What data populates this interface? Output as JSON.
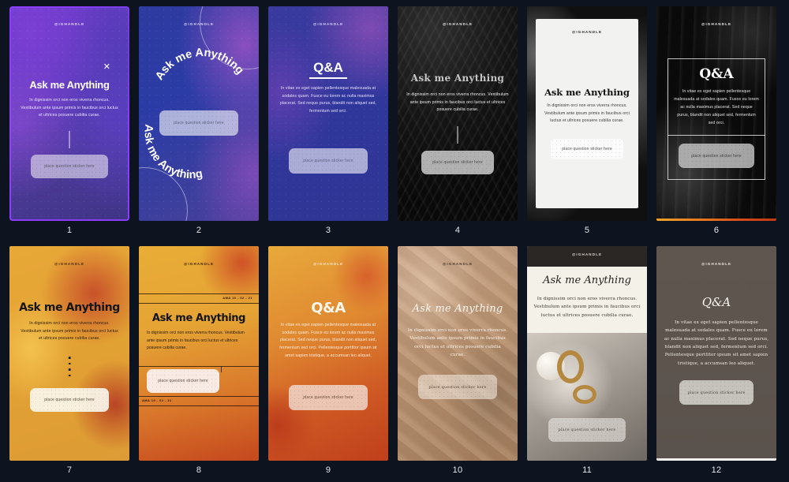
{
  "app": {
    "background_color": "#0e1320",
    "selected_index": 1,
    "columns": 6,
    "rows": 2
  },
  "common": {
    "handle": "@IGHANDLE",
    "sticker_label": "place question sticker here",
    "body_short": "In dignissim orci non eros viverra rhoncus. Vestibulum ante ipsum primis in faucibus orci luctus et ultrices posuere cubilia curae.",
    "body_medium": "In vitae ex eget sapien pellentesque malesuada at sodales quam. Fusce eu lorem ac nulla maximus placerat. Sed neque purus, blandit non aliquet sed, fermentum sed orci.",
    "body_long": "In vitae ex eget sapien pellentesque malesuada at sodales quam. Fusce eu lorem ac nulla maximus placerat. Sed neque purus, blandit non aliquet sed, fermentum sed orci. Pellentesque porttitor ipsum sit amet sapien tristique, a accumsan leo aliquet.",
    "close_icon": "close-icon"
  },
  "templates": [
    {
      "number": "1",
      "title": "Ask me Anything",
      "handle": "@IGHANDLE",
      "body": "In dignissim orci non eros viverra rhoncus. Vestibulum ante ipsum primis in faucibus orci luctus et ultrices posuere cubilia curae.",
      "sticker": "place question sticker here",
      "selected": true,
      "accent": "#8b3dff",
      "theme": "purple-gradient",
      "has_close_icon": true
    },
    {
      "number": "2",
      "title": "Ask me Anything",
      "title_alt": "Ask me Anything",
      "handle": "@IGHANDLE",
      "body": "",
      "sticker": "place question sticker here",
      "selected": false,
      "accent": "#2e3ba0",
      "theme": "blue-arc"
    },
    {
      "number": "3",
      "title": "Q&A",
      "handle": "@IGHANDLE",
      "body": "In vitae ex eget sapien pellentesque malesuada at sodales quam. Fusce eu lorem ac nulla maximus placerat. Sed neque purus, blandit non aliquet sed, fermentum sed orci.",
      "sticker": "place question sticker here",
      "selected": false,
      "accent": "#3a3a9e",
      "theme": "blue-violet"
    },
    {
      "number": "4",
      "title": "Ask me Anything",
      "handle": "@IGHANDLE",
      "body": "In dignissim orci non eros viverra rhoncus. Vestibulum ante ipsum primis in faucibus orci luctus et ultrices posuere cubilia curae.",
      "sticker": "place question sticker here",
      "selected": false,
      "accent": "#141414",
      "theme": "dark-sand-gothic"
    },
    {
      "number": "5",
      "title": "Ask me Anything",
      "handle": "@IGHANDLE",
      "body": "In dignissim orci non eros viverra rhoncus. Vestibulum ante ipsum primis in faucibus orci luctus et ultrices posuere cubilia curae.",
      "sticker": "place question sticker here",
      "selected": false,
      "accent": "#f2f2f0",
      "theme": "white-card"
    },
    {
      "number": "6",
      "title": "Q&A",
      "handle": "@IGHANDLE",
      "body": "In vitae ex eget sapien pellentesque malesuada at sodales quam. Fusce eu lorem ac nulla maximus placerat. Sed neque purus, blandit non aliquet sed, fermentum sed orci.",
      "sticker": "place question sticker here",
      "selected": false,
      "accent": "#e8761f",
      "theme": "dark-framed"
    },
    {
      "number": "7",
      "title": "Ask me Anything",
      "handle": "@IGHANDLE",
      "body": "In dignissim orci non eros viverra rhoncus. Vestibulum ante ipsum primis in faucibus orci luctus et ultrices posuere cubilia curae.",
      "sticker": "place question sticker here",
      "selected": false,
      "accent": "#e8a838",
      "theme": "amber-gradient"
    },
    {
      "number": "8",
      "title": "Ask me Anything",
      "handle": "@IGHANDLE",
      "body": "In dignissim orci non eros viverra rhoncus. Vestibulum ante ipsum primis in faucibus orci luctus et ultrices posuere cubilia curae.",
      "sticker": "place question sticker here",
      "stamp": "AMA 10 - 02 - 21",
      "selected": false,
      "accent": "#e5a334",
      "theme": "amber-grid"
    },
    {
      "number": "9",
      "title": "Q&A",
      "handle": "@IGHANDLE",
      "body": "In vitae ex eget sapien pellentesque malesuada at sodales quam. Fusce eu lorem ac nulla maximus placerat. Sed neque purus, blandit non aliquet sed, fermentum sed orci. Pellentesque porttitor ipsum sit amet sapien tristique, a accumsan leo aliquet.",
      "sticker": "place question sticker here",
      "selected": false,
      "accent": "#cf5a24",
      "theme": "orange-gradient"
    },
    {
      "number": "10",
      "title": "Ask me Anything",
      "handle": "@IGHANDLE",
      "body": "In dignissim orci non eros viverra rhoncus. Vestibulum ante ipsum primis in faucibus orci luctus et ultrices posuere cubilia curae.",
      "sticker": "place question sticker here",
      "selected": false,
      "accent": "#c9a486",
      "theme": "tan-fabric-script"
    },
    {
      "number": "11",
      "title": "Ask me Anything",
      "handle": "@IGHANDLE",
      "body": "In dignissim orci non eros viverra rhoncus. Vestibulum ante ipsum primis in faucibus orci luctus et ultrices posuere cubilia curae.",
      "sticker": "place question sticker here",
      "selected": false,
      "accent": "#f4f1e9",
      "theme": "photo-panel"
    },
    {
      "number": "12",
      "title": "Q&A",
      "handle": "@IGHANDLE",
      "body": "In vitae ex eget sapien pellentesque malesuada at sodales quam. Fusce eu lorem ac nulla maximus placerat. Sed neque purus, blandit non aliquet sed, fermentum sed orci. Pellentesque porttitor ipsum sit amet sapien tristique, a accumsan leo aliquet.",
      "sticker": "place question sticker here",
      "selected": false,
      "accent": "#5d544e",
      "theme": "taupe-script"
    }
  ]
}
